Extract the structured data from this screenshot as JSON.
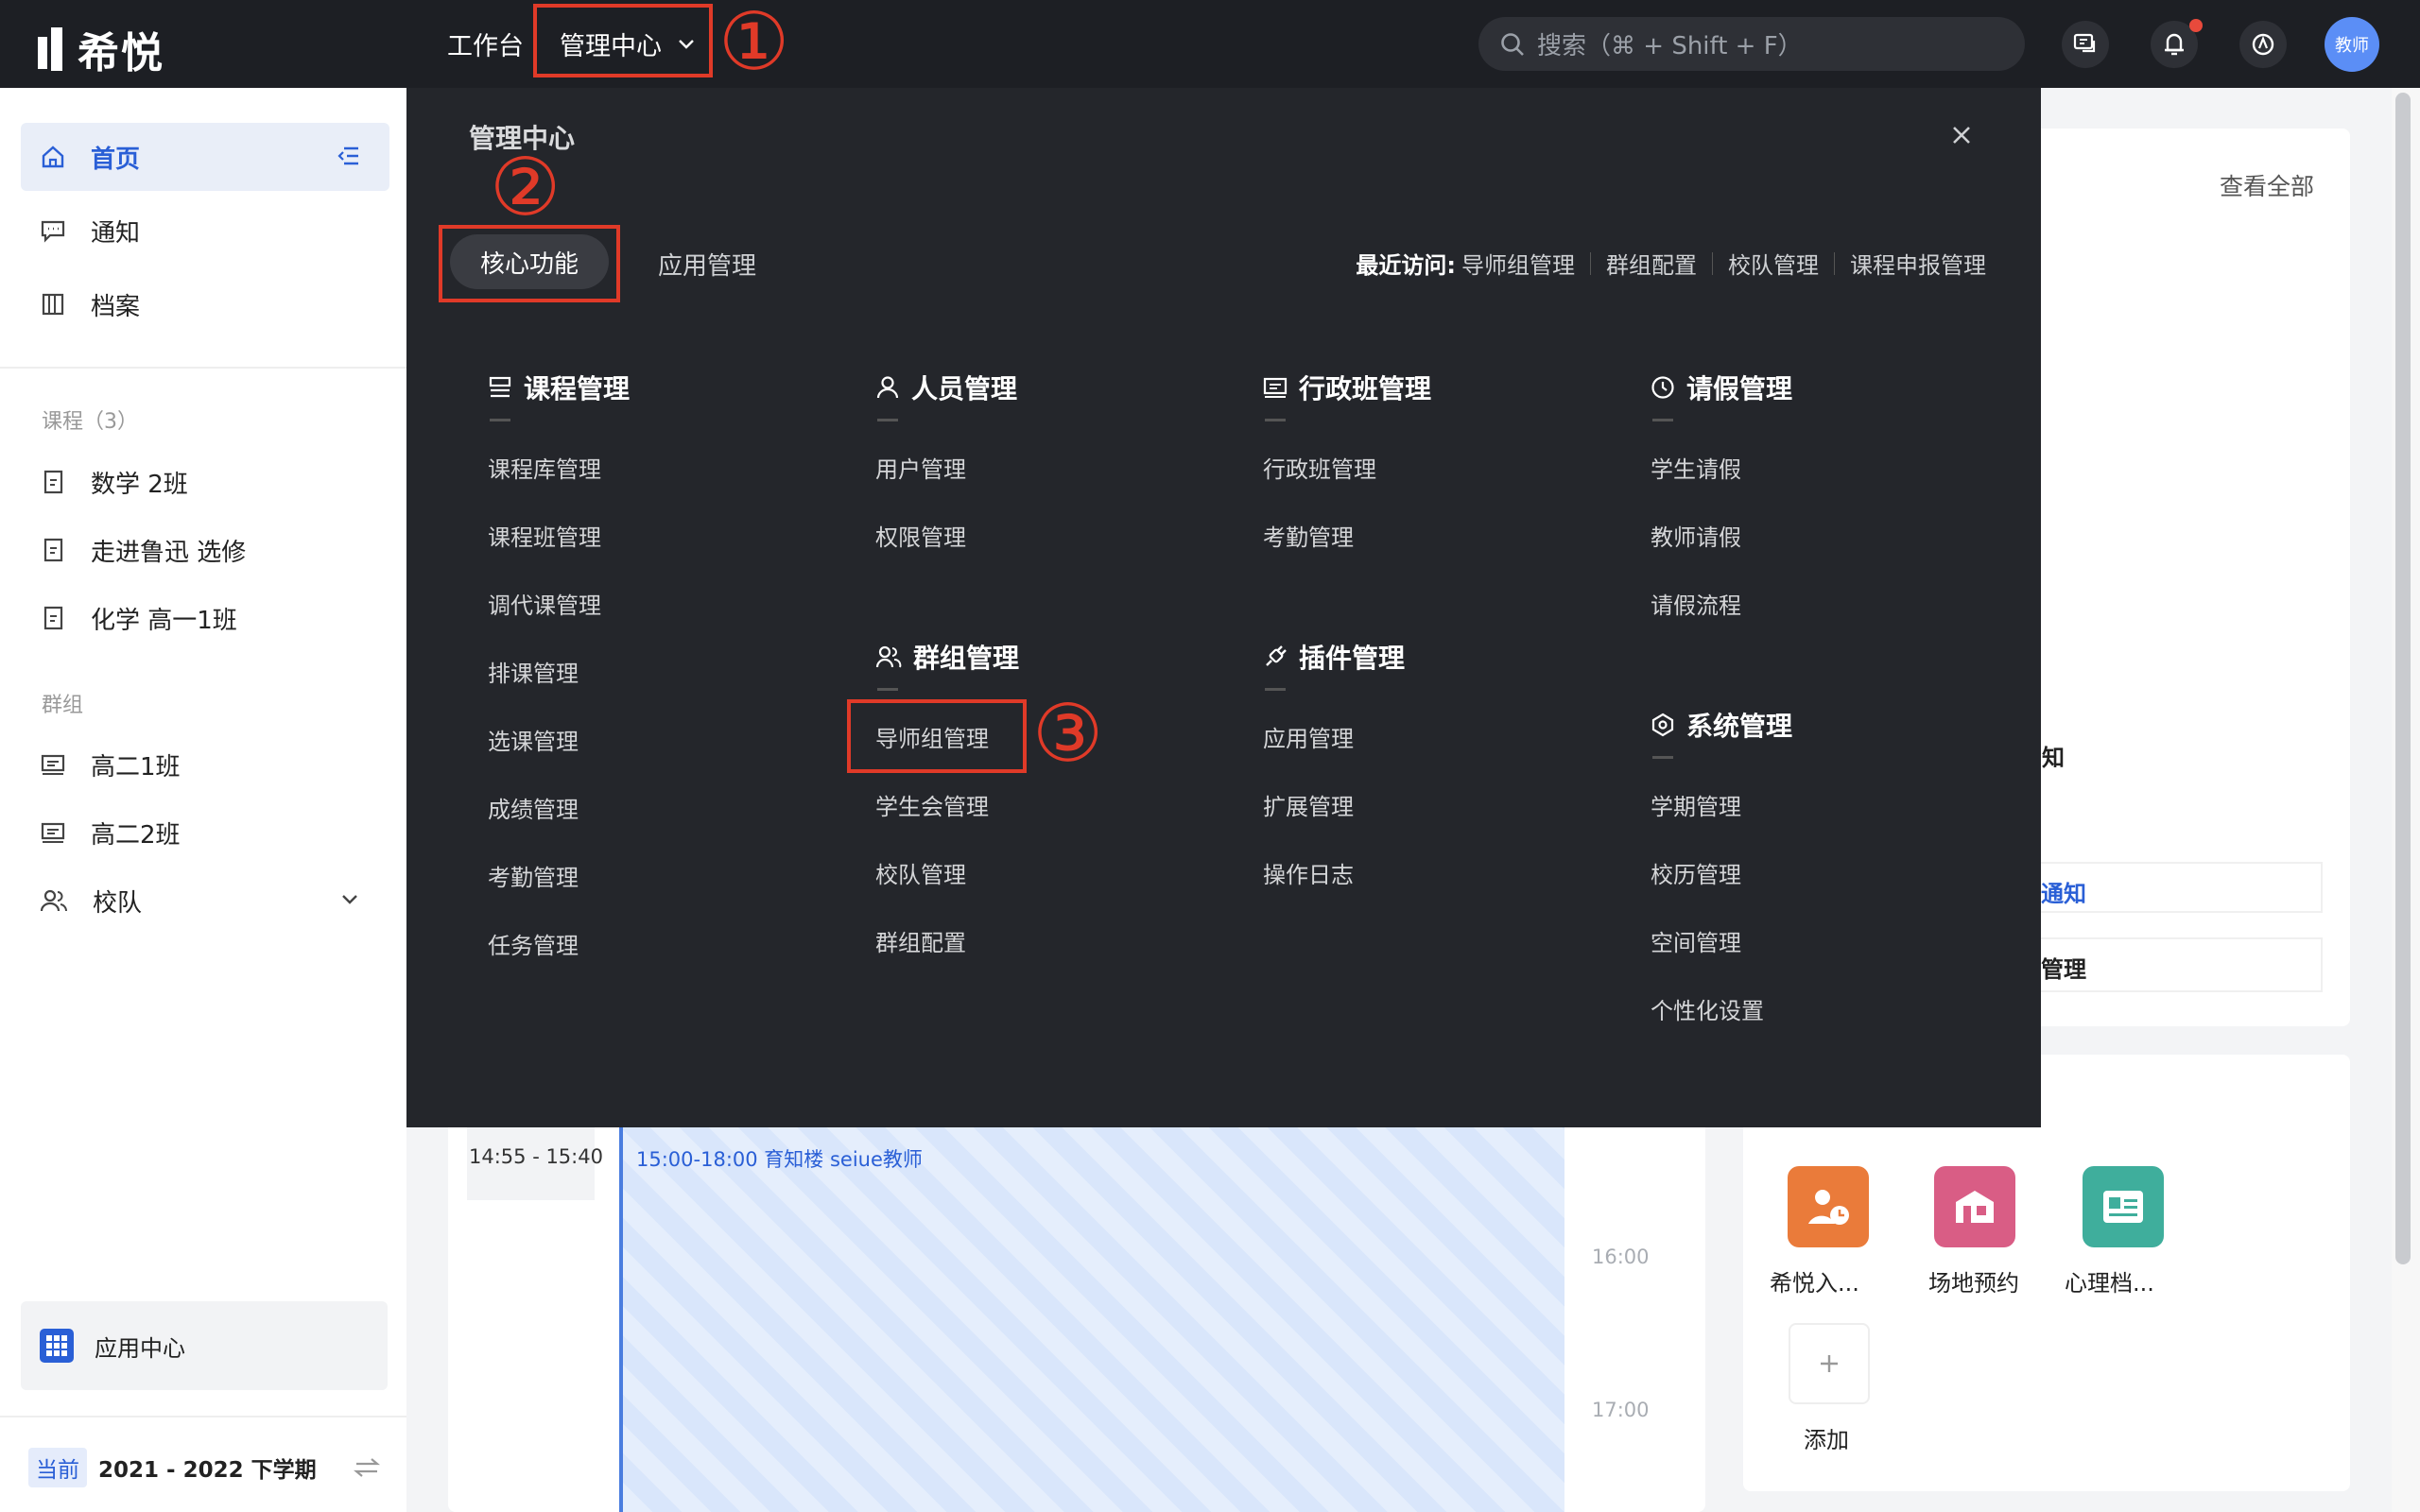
{
  "topbar": {
    "logo": "希悦",
    "nav": [
      "工作台",
      "管理中心"
    ],
    "search_placeholder": "搜索（⌘ + Shift + F）",
    "avatar": "教师"
  },
  "sidebar": {
    "home": "首页",
    "notice": "通知",
    "archive": "档案",
    "courses_label": "课程（3）",
    "courses": [
      "数学 2班",
      "走进鲁迅 选修",
      "化学 高一1班"
    ],
    "groups_label": "群组",
    "groups": [
      "高二1班",
      "高二2班",
      "校队"
    ],
    "app_center": "应用中心",
    "term_badge": "当前",
    "term": "2021 - 2022 下学期"
  },
  "background": {
    "view_all": "查看全部",
    "frag1": "知",
    "frag2": "通知",
    "frag3": "管理",
    "time_range": "14:55 - 15:40",
    "event": "15:00-18:00  育知楼  seiue教师",
    "hour16": "16:00",
    "hour17": "17:00",
    "apps": [
      "希悦入...",
      "场地预约",
      "心理档..."
    ],
    "add": "添加",
    "app_colors": [
      "#ea7b3a",
      "#d95d85",
      "#3fae9c"
    ]
  },
  "panel": {
    "title": "管理中心",
    "tabs": [
      "核心功能",
      "应用管理"
    ],
    "recent_label": "最近访问:",
    "recent": [
      "导师组管理",
      "群组配置",
      "校队管理",
      "课程申报管理"
    ],
    "sections": {
      "course": {
        "title": "课程管理",
        "items": [
          "课程库管理",
          "课程班管理",
          "调代课管理",
          "排课管理",
          "选课管理",
          "成绩管理",
          "考勤管理",
          "任务管理"
        ]
      },
      "people": {
        "title": "人员管理",
        "items": [
          "用户管理",
          "权限管理"
        ]
      },
      "group": {
        "title": "群组管理",
        "items": [
          "导师组管理",
          "学生会管理",
          "校队管理",
          "群组配置"
        ]
      },
      "admin_class": {
        "title": "行政班管理",
        "items": [
          "行政班管理",
          "考勤管理"
        ]
      },
      "plugin": {
        "title": "插件管理",
        "items": [
          "应用管理",
          "扩展管理",
          "操作日志"
        ]
      },
      "leave": {
        "title": "请假管理",
        "items": [
          "学生请假",
          "教师请假",
          "请假流程"
        ]
      },
      "system": {
        "title": "系统管理",
        "items": [
          "学期管理",
          "校历管理",
          "空间管理",
          "个性化设置"
        ]
      }
    }
  },
  "annotations": [
    "①",
    "②",
    "③"
  ]
}
